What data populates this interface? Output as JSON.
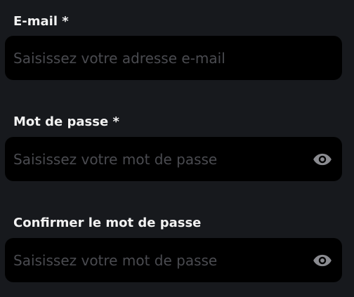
{
  "form": {
    "email": {
      "label": "E-mail *",
      "value": "",
      "placeholder": "Saisissez votre adresse e-mail"
    },
    "password": {
      "label": "Mot de passe *",
      "value": "",
      "placeholder": "Saisissez votre mot de passe",
      "toggle_icon": "eye-icon"
    },
    "confirm_password": {
      "label": "Confirmer le mot de passe",
      "value": "",
      "placeholder": "Saisissez votre mot de passe",
      "toggle_icon": "eye-icon"
    }
  },
  "colors": {
    "background": "#17191d",
    "input_background": "#000000",
    "label_text": "#f2f2f2",
    "placeholder_text": "#4a4b50",
    "icon": "#8a8b90"
  }
}
